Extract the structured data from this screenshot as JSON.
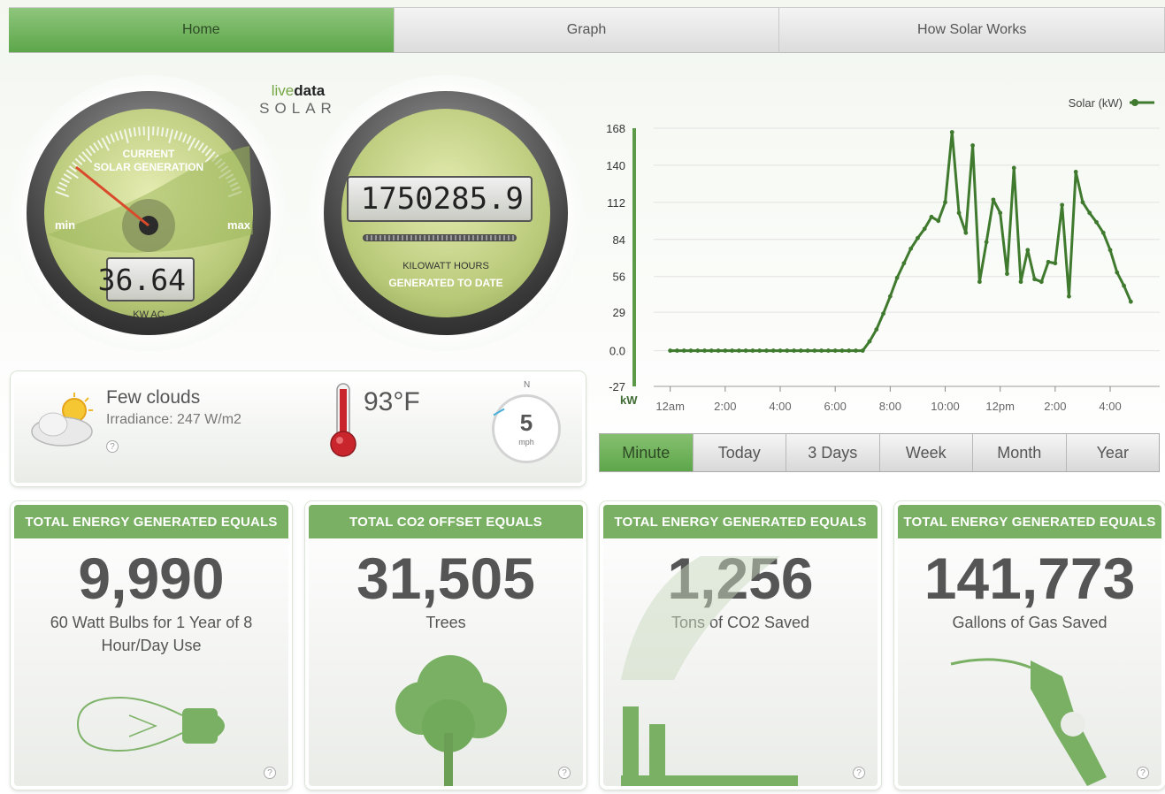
{
  "nav": {
    "tabs": [
      {
        "label": "Home",
        "active": true
      },
      {
        "label": "Graph",
        "active": false
      },
      {
        "label": "How Solar Works",
        "active": false
      }
    ]
  },
  "logo": {
    "live": "live",
    "data": "data",
    "solar": "SOLAR"
  },
  "current_gauge": {
    "title_line1": "CURRENT",
    "title_line2": "SOLAR GENERATION",
    "min": "min",
    "max": "max",
    "value": "36.64",
    "unit": "KW AC"
  },
  "total_gauge": {
    "value": "1750285.9",
    "unit_line1": "KILOWATT HOURS",
    "unit_line2": "GENERATED TO DATE"
  },
  "weather": {
    "condition": "Few clouds",
    "irradiance": "Irradiance: 247 W/m2",
    "help": "?",
    "temperature": "93°F",
    "wind_dir": "N",
    "wind_speed": "5",
    "wind_unit": "mph"
  },
  "chart_data": {
    "type": "line",
    "legend": "Solar (kW)",
    "legend_position": "top-right",
    "ylabel": "kW",
    "y_ticks": [
      "168",
      "140",
      "112",
      "84",
      "56",
      "29",
      "0.0",
      "-27"
    ],
    "y_tick_values": [
      168,
      140,
      112,
      84,
      56,
      29,
      0,
      -27
    ],
    "ylim": [
      -27,
      168
    ],
    "x_ticks": [
      "12am",
      "2:00",
      "4:00",
      "6:00",
      "8:00",
      "10:00",
      "12pm",
      "2:00",
      "4:00"
    ],
    "x_tick_values": [
      0,
      2,
      4,
      6,
      8,
      10,
      12,
      14,
      16
    ],
    "xlim": [
      -0.6,
      17.8
    ],
    "grid": true,
    "series": [
      {
        "name": "Solar (kW)",
        "color": "#3f7a2e",
        "x": [
          0,
          0.25,
          0.5,
          0.75,
          1,
          1.25,
          1.5,
          1.75,
          2,
          2.25,
          2.5,
          2.75,
          3,
          3.25,
          3.5,
          3.75,
          4,
          4.25,
          4.5,
          4.75,
          5,
          5.25,
          5.5,
          5.75,
          6,
          6.25,
          6.5,
          6.75,
          7,
          7.25,
          7.5,
          7.75,
          8,
          8.25,
          8.5,
          8.75,
          9,
          9.25,
          9.5,
          9.75,
          10,
          10.25,
          10.5,
          10.75,
          11,
          11.25,
          11.5,
          11.75,
          12,
          12.25,
          12.5,
          12.75,
          13,
          13.25,
          13.5,
          13.75,
          14,
          14.25,
          14.5,
          14.75,
          15,
          15.25,
          15.5,
          15.75,
          16,
          16.25,
          16.5,
          16.75
        ],
        "y": [
          0,
          0,
          0,
          0,
          0,
          0,
          0,
          0,
          0,
          0,
          0,
          0,
          0,
          0,
          0,
          0,
          0,
          0,
          0,
          0,
          0,
          0,
          0,
          0,
          0,
          0,
          0,
          0,
          0,
          7,
          16,
          28,
          41,
          55,
          66,
          77,
          85,
          92,
          101,
          98,
          112,
          165,
          104,
          89,
          155,
          52,
          82,
          114,
          104,
          58,
          138,
          52,
          76,
          54,
          52,
          67,
          66,
          110,
          41,
          135,
          112,
          104,
          97,
          89,
          76,
          59,
          49,
          37
        ]
      }
    ]
  },
  "ranges": [
    {
      "label": "Minute",
      "active": true
    },
    {
      "label": "Today",
      "active": false
    },
    {
      "label": "3 Days",
      "active": false
    },
    {
      "label": "Week",
      "active": false
    },
    {
      "label": "Month",
      "active": false
    },
    {
      "label": "Year",
      "active": false
    }
  ],
  "cards": [
    {
      "header": "TOTAL ENERGY GENERATED EQUALS",
      "value": "9,990",
      "desc": "60 Watt Bulbs for 1 Year of 8 Hour/Day Use",
      "icon": "lightbulb-icon"
    },
    {
      "header": "TOTAL CO2 OFFSET EQUALS",
      "value": "31,505",
      "desc": "Trees",
      "icon": "tree-icon"
    },
    {
      "header": "TOTAL ENERGY GENERATED EQUALS",
      "value": "1,256",
      "desc": "Tons of CO2 Saved",
      "icon": "smokestack-icon"
    },
    {
      "header": "TOTAL ENERGY GENERATED EQUALS",
      "value": "141,773",
      "desc": "Gallons of Gas Saved",
      "icon": "gas-nozzle-icon"
    }
  ],
  "card_help": "?",
  "colors": {
    "accent": "#79b063",
    "accent_dark": "#5da64a",
    "line": "#3f7a2e",
    "lcd_text": "#222222"
  }
}
